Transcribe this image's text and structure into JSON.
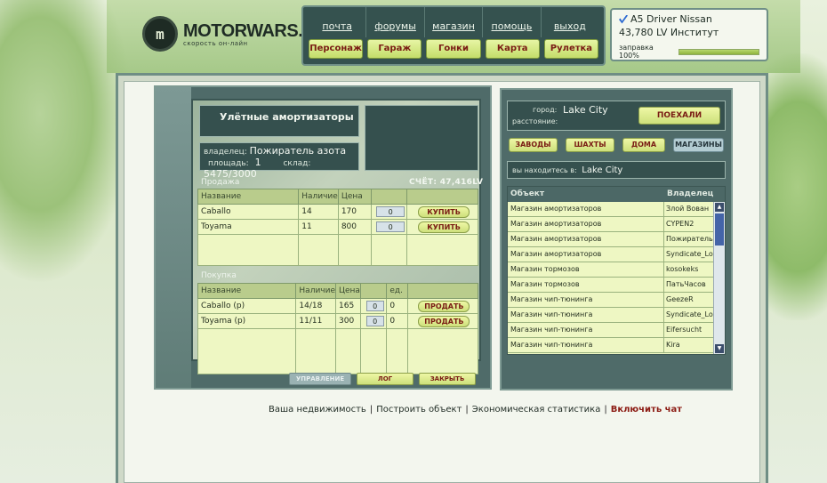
{
  "site": {
    "brand": "MOTORWARS.RU",
    "tagline": "скорость он-лайн",
    "logo_glyph": "m"
  },
  "nav": {
    "links": [
      "почта",
      "форумы",
      "магазин",
      "помощь",
      "выход"
    ],
    "buttons": [
      "Персонаж",
      "Гараж",
      "Гонки",
      "Карта",
      "Рулетка"
    ]
  },
  "user": {
    "car": "A5 Driver Nissan",
    "money_line": "43,780 LV Институт",
    "fuel_label": "заправка 100%",
    "fuel_level": 1.0
  },
  "shop": {
    "name": "Улётные амортизаторы",
    "owner_label": "владелец:",
    "owner": "Пожиратель азота",
    "area_label": "площадь:",
    "area": "1",
    "warehouse_label": "склад:",
    "warehouse": "5475/3000",
    "sale_title": "Продажа",
    "score": "СЧЁТ: 47,416LV",
    "sale_headers": [
      "Название",
      "Наличие",
      "Цена",
      "",
      ""
    ],
    "sale_rows": [
      {
        "name": "Caballo",
        "stock": "14",
        "price": "170",
        "qty": "0",
        "action": "КУПИТЬ"
      },
      {
        "name": "Toyama",
        "stock": "11",
        "price": "800",
        "qty": "0",
        "action": "КУПИТЬ"
      }
    ],
    "buy_title": "Покупка",
    "buy_headers": [
      "Название",
      "Наличие",
      "Цена",
      "",
      "ед.",
      ""
    ],
    "buy_rows": [
      {
        "name": "Caballo (р)",
        "stock": "14/18",
        "price": "165",
        "qty": "0",
        "unit": "0",
        "action": "ПРОДАТЬ"
      },
      {
        "name": "Toyama (р)",
        "stock": "11/11",
        "price": "300",
        "qty": "0",
        "unit": "0",
        "action": "ПРОДАТЬ"
      }
    ],
    "bottom_buttons": {
      "manage": "УПРАВЛЕНИЕ",
      "log": "ЛОГ",
      "close": "ЗАКРЫТЬ"
    }
  },
  "city": {
    "city_label": "город:",
    "city": "Lake City",
    "distance_label": "расстояние:",
    "go_button": "ПОЕХАЛИ",
    "categories": [
      "ЗАВОДЫ",
      "ШАХТЫ",
      "ДОМА",
      "МАГАЗИНЫ"
    ],
    "here_label": "вы находитесь в:",
    "here": "Lake City",
    "objects_headers": [
      "Объект",
      "Владелец"
    ],
    "objects": [
      {
        "object": "Магазин амортизаторов",
        "owner": "Злой Вован"
      },
      {
        "object": "Магазин амортизаторов",
        "owner": "CYPEN2"
      },
      {
        "object": "Магазин амортизаторов",
        "owner": "Пожиратель а"
      },
      {
        "object": "Магазин амортизаторов",
        "owner": "Syndicate_Lov"
      },
      {
        "object": "Магазин тормозов",
        "owner": "kosokeks"
      },
      {
        "object": "Магазин тормозов",
        "owner": "ПатьЧасов"
      },
      {
        "object": "Магазин чип-тюнинга",
        "owner": "GeezeR"
      },
      {
        "object": "Магазин чип-тюнинга",
        "owner": "Syndicate_Lov"
      },
      {
        "object": "Магазин чип-тюнинга",
        "owner": "Eifersucht"
      },
      {
        "object": "Магазин чип-тюнинга",
        "owner": "Kira"
      }
    ]
  },
  "footer": {
    "links": [
      "Ваша недвижимость",
      "Построить объект",
      "Экономическая статистика"
    ],
    "chat": "Включить чат",
    "separator": "|"
  }
}
